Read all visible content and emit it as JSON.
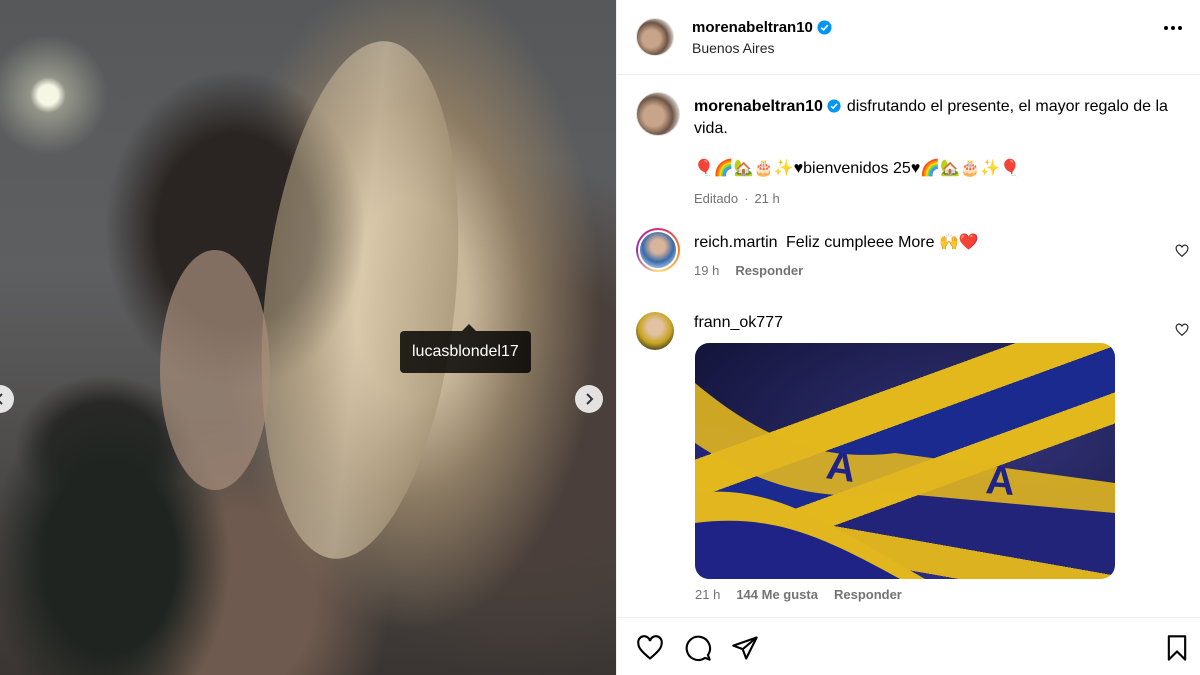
{
  "photo": {
    "tag": "lucasblondel17"
  },
  "header": {
    "username": "morenabeltran10",
    "location": "Buenos Aires"
  },
  "caption": {
    "username": "morenabeltran10",
    "text": "disfrutando el presente, el mayor regalo de la vida.",
    "line2": "🎈🌈🏡🎂✨♥bienvenidos 25♥🌈🏡🎂✨🎈",
    "edited": "Editado",
    "time": "21 h"
  },
  "comments": [
    {
      "username": "reich.martin",
      "text": "Feliz cumpleee More 🙌❤️",
      "time": "19 h",
      "reply": "Responder"
    },
    {
      "username": "frann_ok777",
      "time": "21 h",
      "likes": "144 Me gusta",
      "reply": "Responder"
    }
  ],
  "colors": {
    "verified": "#0095f6",
    "muted": "#737373"
  }
}
